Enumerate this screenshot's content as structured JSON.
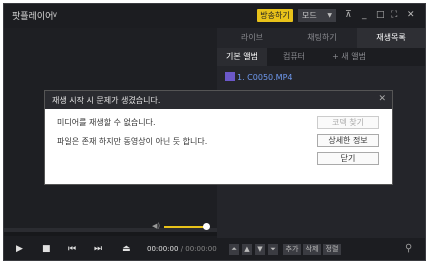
{
  "app": {
    "title": "팟플레이어"
  },
  "titlebar": {
    "broadcast_label": "방송하기",
    "mode_label": "모드"
  },
  "side": {
    "tabs": [
      "라이브",
      "채팅하기",
      "재생목록"
    ],
    "subtabs": [
      "기본 앨범",
      "컴퓨터",
      "+ 새 앨범"
    ],
    "playlist": [
      {
        "label": "1. C0050.MP4"
      }
    ],
    "bottom_buttons": [
      "추가",
      "삭제",
      "정렬"
    ]
  },
  "player": {
    "time_current": "00:00:00",
    "time_total": "/ 00:00:00",
    "volume": 0.85
  },
  "dialog": {
    "title": "재생 시작 시 문제가 생겼습니다.",
    "messages": [
      "미디어를 재생할 수 없습니다.",
      "파일은 존재 하지만 동영상이 아닌 듯 합니다."
    ],
    "buttons": {
      "codec": "코덱 찾기",
      "details": "상세한 정보",
      "close": "닫기"
    }
  },
  "colors": {
    "accent": "#e8c21a",
    "playlist_item": "#6f9af0",
    "background": "#17181b"
  }
}
